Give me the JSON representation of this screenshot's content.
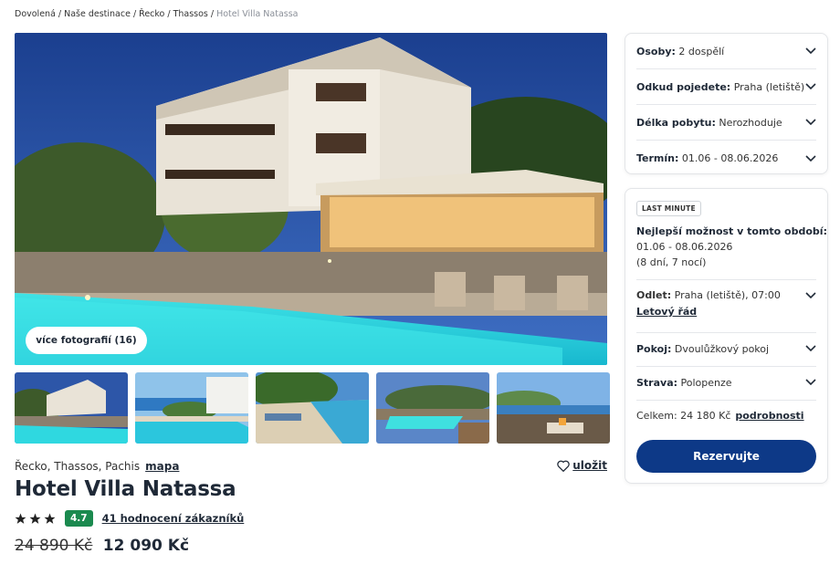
{
  "breadcrumb": {
    "items": [
      "Dovolená",
      "Naše destinace",
      "Řecko",
      "Thassos"
    ],
    "current": "Hotel Villa Natassa",
    "separator": "/"
  },
  "gallery": {
    "more_photos_label": "více fotografií (16)"
  },
  "hotel": {
    "location": "Řecko, Thassos, Pachis",
    "map_link": "mapa",
    "save_label": "uložit",
    "name": "Hotel Villa Natassa",
    "stars": 3,
    "rating": "4.7",
    "reviews_label": "41 hodnocení zákazníků",
    "old_price": "24 890 Kč",
    "new_price": "12 090 Kč"
  },
  "search": {
    "persons": {
      "label": "Osoby:",
      "value": "2 dospělí"
    },
    "departure_from": {
      "label": "Odkud pojedete:",
      "value": "Praha (letiště)"
    },
    "stay_length": {
      "label": "Délka pobytu:",
      "value": "Nerozhoduje"
    },
    "term": {
      "label": "Termín:",
      "value": "01.06 - 08.06.2026"
    }
  },
  "offer": {
    "badge": "LAST MINUTE",
    "best_option_label": "Nejlepší možnost v tomto období:",
    "dates": "01.06 - 08.06.2026",
    "duration": "(8 dní, 7 nocí)",
    "departure": {
      "label": "Odlet:",
      "value": "Praha (letiště), 07:00"
    },
    "flight_schedule_link": "Letový řád",
    "room": {
      "label": "Pokoj:",
      "value": "Dvoulůžkový pokoj"
    },
    "board": {
      "label": "Strava:",
      "value": "Polopenze"
    },
    "total_label": "Celkem: 24 180 Kč",
    "details_link": "podrobnosti",
    "reserve_label": "Rezervujte"
  },
  "colors": {
    "primary_button": "#0d3987",
    "rating_badge": "#1b8a4f",
    "text": "#1f2937"
  }
}
